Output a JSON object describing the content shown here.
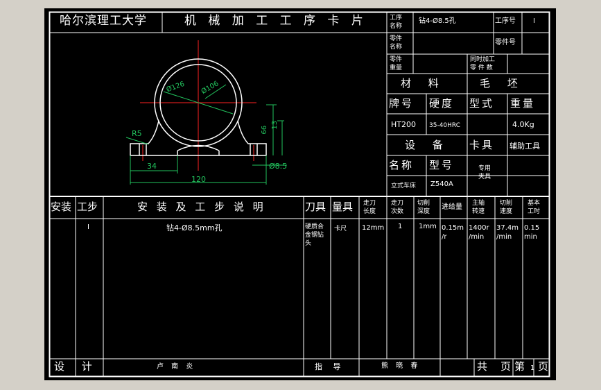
{
  "card": {
    "university": "哈尔滨理工大学",
    "title": "机 械 加 工 工 序 卡 片",
    "proc_name_label": "工序\n名称",
    "proc_name_value": "钻4-Ø8.5孔",
    "proc_no_label": "工序号",
    "proc_no_value": "I",
    "part_name_label": "零件\n名称",
    "part_no_label": "零件号",
    "part_weight_label": "零件\n重量",
    "simul_label": "同时加工\n零 件 数",
    "material_label": "材 料",
    "blank_label": "毛 坯",
    "brand_label": "牌号",
    "hardness_label": "硬度",
    "form_label": "型式",
    "weight_label": "重量",
    "brand_value": "HT200",
    "hardness_value": "35-40HRC",
    "weight_value": "4.0Kg",
    "equipment_label": "设 备",
    "fixture_label": "卡具",
    "aux_tool_label": "辅助工具",
    "name_label": "名称",
    "model_label": "型号",
    "equip_name_value": "立式车床",
    "equip_model_value": "Z540A",
    "fixture_value": "专用\n夹具"
  },
  "drawing": {
    "dim_d126": "Ø126",
    "dim_d106": "Ø106",
    "dim_r5": "R5",
    "dim_66": "66",
    "dim_13": "13",
    "dim_34": "34",
    "dim_120": "120",
    "dim_d85": "Ø8.5"
  },
  "table": {
    "headers": {
      "install": "安装",
      "step": "工步",
      "description": "安 装 及 工 步 说 明",
      "tool": "刀具",
      "gauge": "量具",
      "cut_length": "走刀\n长度",
      "passes": "走刀\n次数",
      "depth": "切削\n深度",
      "feed": "进给量",
      "spindle": "主轴\n转速",
      "speed": "切削\n速度",
      "time": "基本\n工时"
    },
    "row": {
      "step": "I",
      "description": "钻4-Ø8.5mm孔",
      "tool": "硬质合\n金钢钻\n头",
      "gauge": "卡尺",
      "cut_length": "12mm",
      "passes": "1",
      "depth": "1mm",
      "feed": "0.15m\n/r",
      "spindle": "1400r\n/min",
      "speed": "37.4m\n/min",
      "time": "0.15\nmin"
    }
  },
  "footer": {
    "design_label": "设 计",
    "designer": "卢 南 炎",
    "guide_label": "指 导",
    "advisor": "熊 晓 春",
    "total_pages_label": "共",
    "pages_label": "页",
    "page_no_label": "第",
    "page_no": "1",
    "page_suffix": "页"
  },
  "colors": {
    "line": "#ffffff",
    "drawing": "#ffffff",
    "dimension": "#22c55e",
    "center": "#ff2222"
  }
}
